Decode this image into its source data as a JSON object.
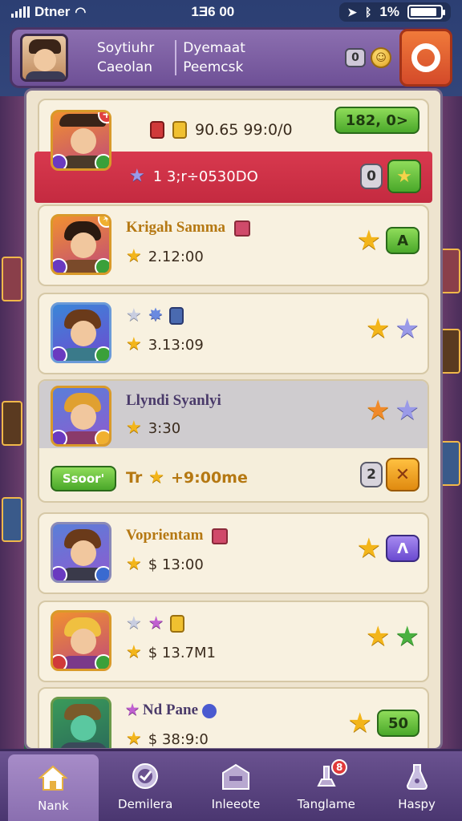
{
  "status": {
    "carrier": "Dtner",
    "time": "1Ǝ6 00",
    "battery": "1%",
    "battery_level": 0.9
  },
  "header": {
    "name_line1": "Soytiuhr",
    "name_line2": "Caeolan",
    "title_line1": "Dyemaat",
    "title_line2": "Peemcsk",
    "chip_value": "0"
  },
  "cards": [
    {
      "value": "90.65 99:0/0",
      "pill": "182, 0>",
      "bar_text": "1 3;r÷0530DO",
      "chip": "0"
    },
    {
      "name": "Krigah Samma",
      "time": "2.12:00",
      "pill": "A"
    },
    {
      "time": "3.13:09"
    },
    {
      "name": "Llyndi Syanlyi",
      "time": "3:30",
      "bottom_button": "Ssoor'",
      "bottom_text": "Tr",
      "bottom_value": "+9:00me",
      "chip": "2"
    },
    {
      "name": "Voprientam",
      "time": "$ 13:00",
      "pill": "Λ"
    },
    {
      "time": "$ 13.7M1"
    },
    {
      "name": "Nd Pane",
      "time": "$ 38:9:0",
      "pill": "50"
    }
  ],
  "nav": [
    {
      "label": "Nank",
      "icon": "home-icon"
    },
    {
      "label": "Demilera",
      "icon": "clock-icon"
    },
    {
      "label": "Inleeote",
      "icon": "building-icon"
    },
    {
      "label": "Tanglame",
      "icon": "trophy-icon",
      "badge": "8"
    },
    {
      "label": "Haspy",
      "icon": "potion-icon"
    }
  ],
  "colors": {
    "accent_red": "#d8394e",
    "accent_green": "#4aa82a",
    "gold": "#f3b51a",
    "header_purple": "#6e5096"
  }
}
